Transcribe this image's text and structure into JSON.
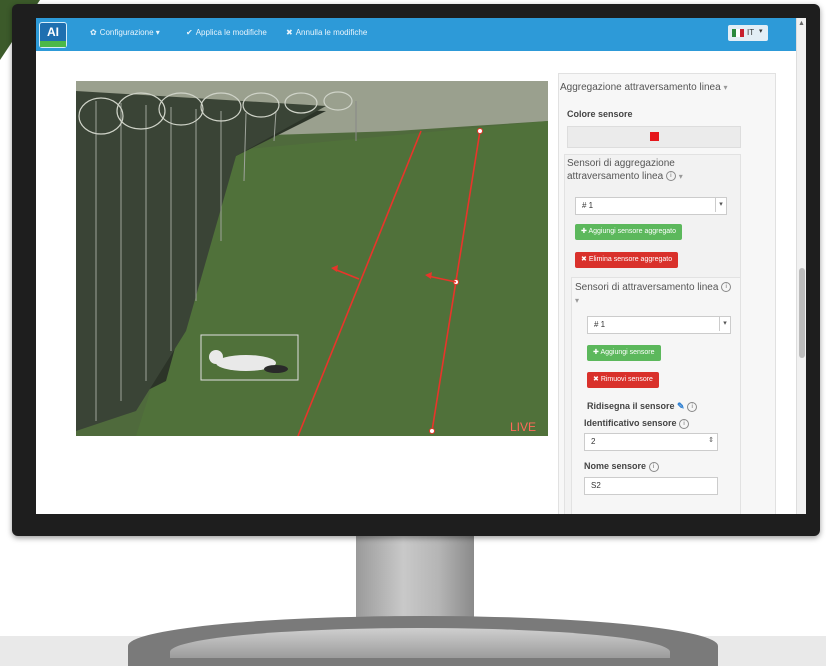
{
  "app": {
    "logo_text": "AI",
    "nav": {
      "config_label": "Configurazione",
      "apply_label": "Applica le modifiche",
      "cancel_label": "Annulla le modifiche"
    },
    "language": "IT"
  },
  "video": {
    "live_label": "LIVE"
  },
  "panel": {
    "title": "Aggregazione attraversamento linea",
    "sensor_color_label": "Colore sensore",
    "sensor_color": "#e5161b",
    "aggregation": {
      "heading": "Sensori di aggregazione attraversamento linea",
      "selected": "# 1",
      "add_label": "Aggiungi sensore aggregato",
      "remove_label": "Elimina sensore aggregato"
    },
    "line_sensors": {
      "heading": "Sensori di attraversamento linea",
      "selected": "# 1",
      "add_label": "Aggiungi sensore",
      "remove_label": "Rimuovi sensore",
      "redraw_label": "Ridisegna il sensore",
      "id_label": "Identificativo sensore",
      "id_value": "2",
      "name_label": "Nome sensore",
      "name_value": "S2"
    }
  },
  "colors": {
    "topbar": "#2d9ad8",
    "green_button": "#5cb85c",
    "red_button": "#d9312b",
    "sensor_line": "#e8352a"
  }
}
